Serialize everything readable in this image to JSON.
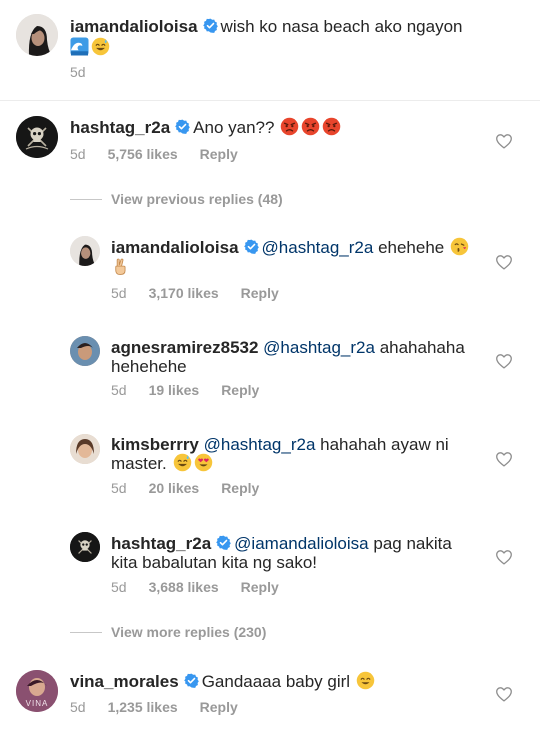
{
  "caption": {
    "username": "iamandalioloisa",
    "text": "wish ko nasa beach ako ngayon",
    "emojis": [
      "wave-emoji",
      "grinning-sweat-emoji"
    ],
    "time": "5d"
  },
  "comments": [
    {
      "username": "hashtag_r2a",
      "verified": true,
      "text": "Ano yan??",
      "emojis": [
        "angry-face-emoji",
        "angry-face-emoji",
        "angry-face-emoji"
      ],
      "time": "5d",
      "likes": "5,756 likes",
      "reply": "Reply"
    }
  ],
  "view_previous": "View previous replies (48)",
  "replies": [
    {
      "username": "iamandalioloisa",
      "verified": true,
      "mention": "@hashtag_r2a",
      "text": "ehehehe",
      "time": "5d",
      "likes": "3,170 likes",
      "reply": "Reply"
    },
    {
      "username": "agnesramirez8532",
      "verified": false,
      "mention": "@hashtag_r2a",
      "text_line1": "ahahahaha",
      "text_line2": "hehehehe",
      "time": "5d",
      "likes": "19 likes",
      "reply": "Reply"
    },
    {
      "username": "kimsberrry",
      "verified": false,
      "mention": "@hashtag_r2a",
      "text_line1": "hahahah ayaw ni",
      "text_line2": "master.",
      "time": "5d",
      "likes": "20 likes",
      "reply": "Reply"
    },
    {
      "username": "hashtag_r2a",
      "verified": true,
      "mention": "@iamandalioloisa",
      "text_line1": "pag nakita",
      "text_line2": "kita babalutan kita ng sako!",
      "time": "5d",
      "likes": "3,688 likes",
      "reply": "Reply"
    }
  ],
  "view_more": "View more replies (230)",
  "last_comment": {
    "username": "vina_morales",
    "verified": true,
    "text": "Gandaaaa baby girl",
    "avatar_text": "VINA",
    "time": "5d",
    "likes": "1,235 likes",
    "reply": "Reply"
  },
  "colors": {
    "verified": "#3897f0",
    "meta": "#999999",
    "mention": "#003569"
  }
}
